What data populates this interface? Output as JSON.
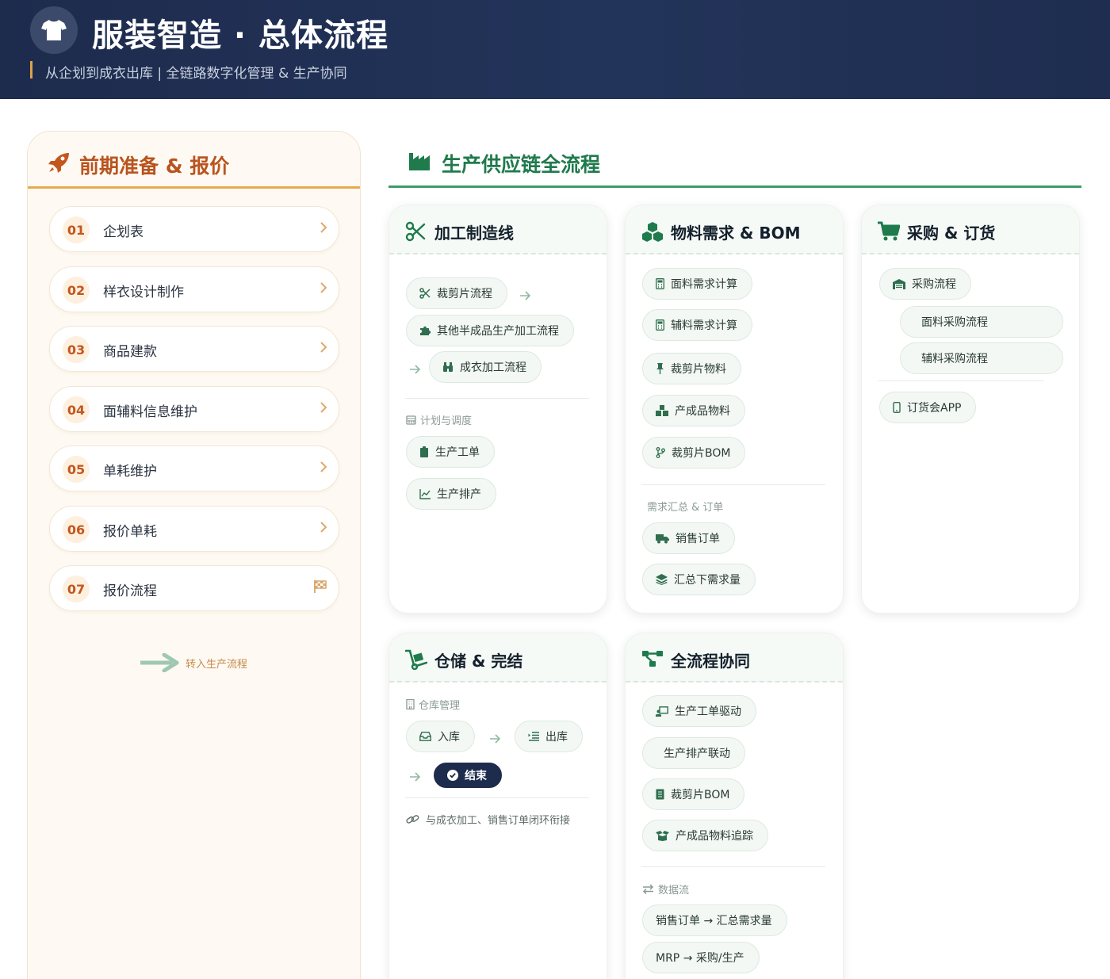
{
  "header": {
    "title": "服装智造 · 总体流程",
    "subtitle": "从企划到成衣出库 | 全链路数字化管理 & 生产协同",
    "logo_icon": "tshirt-icon"
  },
  "prep": {
    "title": "前期准备 & 报价",
    "steps": [
      {
        "num": "01",
        "label": "企划表"
      },
      {
        "num": "02",
        "label": "样衣设计制作"
      },
      {
        "num": "03",
        "label": "商品建款"
      },
      {
        "num": "04",
        "label": "面辅料信息维护"
      },
      {
        "num": "05",
        "label": "单耗维护"
      },
      {
        "num": "06",
        "label": "报价单耗"
      },
      {
        "num": "07",
        "label": "报价流程"
      }
    ],
    "transfer_label": "转入生产流程"
  },
  "supply_chain": {
    "title": "生产供应链全流程"
  },
  "manufacturing": {
    "title": "加工制造线",
    "items": [
      "裁剪片流程",
      "其他半成品生产加工流程",
      "成衣加工流程"
    ],
    "plan_label": "计划与调度",
    "plan_items": [
      "生产工单",
      "生产排产"
    ]
  },
  "materials": {
    "title": "物料需求 & BOM",
    "items": [
      "面料需求计算",
      "辅料需求计算",
      "裁剪片物料",
      "产成品物料",
      "裁剪片BOM"
    ],
    "summary_label": "需求汇总 & 订单",
    "summary_items": [
      "销售订单",
      "汇总下需求量"
    ]
  },
  "purchase": {
    "title": "采购 & 订货",
    "main": "采购流程",
    "sub_items": [
      "面料采购流程",
      "辅料采购流程"
    ],
    "app": "订货会APP"
  },
  "warehouse": {
    "title": "仓储 & 完结",
    "manage_label": "仓库管理",
    "in": "入库",
    "out": "出库",
    "end": "结束",
    "note": "与成衣加工、销售订单闭环衔接"
  },
  "collab": {
    "title": "全流程协同",
    "items": [
      "生产工单驱动",
      "生产排产联动",
      "裁剪片BOM",
      "产成品物料追踪"
    ],
    "flow_label": "数据流",
    "flow_items": [
      "销售订单 → 汇总需求量",
      "MRP → 采购/生产"
    ]
  },
  "colors": {
    "header_bg": "#1d2b4d",
    "prep_accent": "#b9541f",
    "supply_accent": "#1f7a4c",
    "orange_line": "#e9a94e",
    "green_line": "#3f9a6c"
  }
}
